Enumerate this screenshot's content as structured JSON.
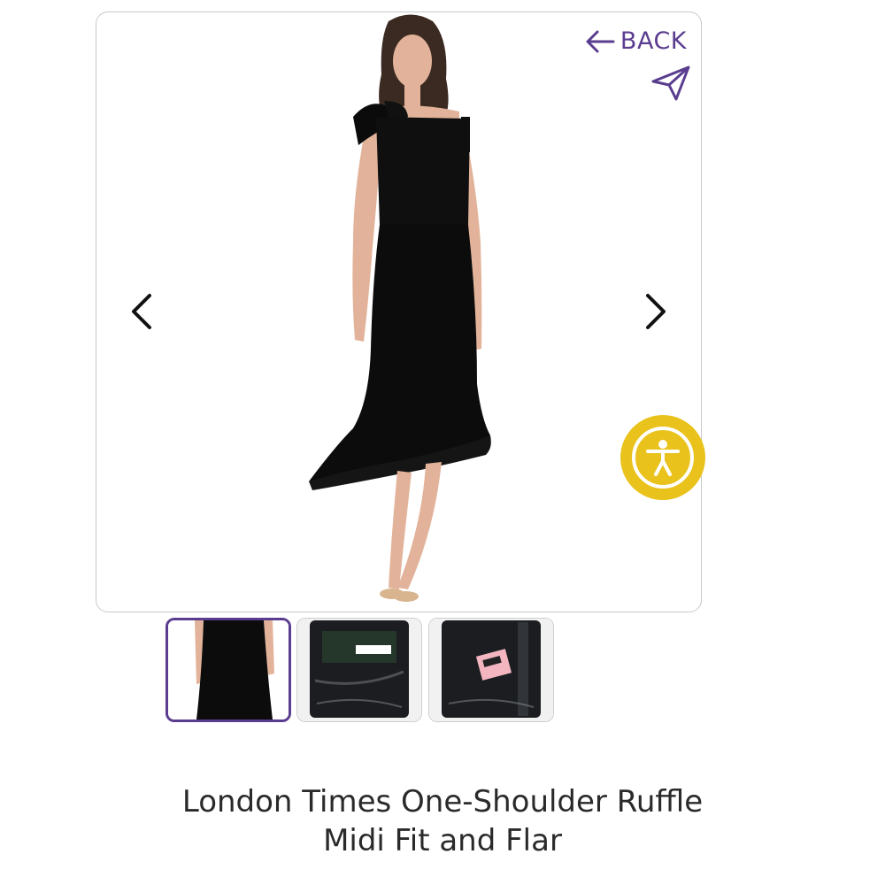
{
  "header": {
    "back_label": "BACK"
  },
  "gallery": {
    "thumbnails": [
      {
        "alt": "dress-front-crop",
        "active": true
      },
      {
        "alt": "dress-in-bag"
      },
      {
        "alt": "dress-in-bag-tag"
      }
    ]
  },
  "product": {
    "title_line1": "London Times One-Shoulder Ruffle",
    "title_line2": "Midi Fit and Flar"
  },
  "colors": {
    "accent": "#5b3d8f",
    "a11y": "#e9c21c",
    "text": "#2a2a2a"
  },
  "icons": [
    "back-arrow-icon",
    "share-send-icon",
    "chevron-left-icon",
    "chevron-right-icon",
    "accessibility-icon"
  ]
}
